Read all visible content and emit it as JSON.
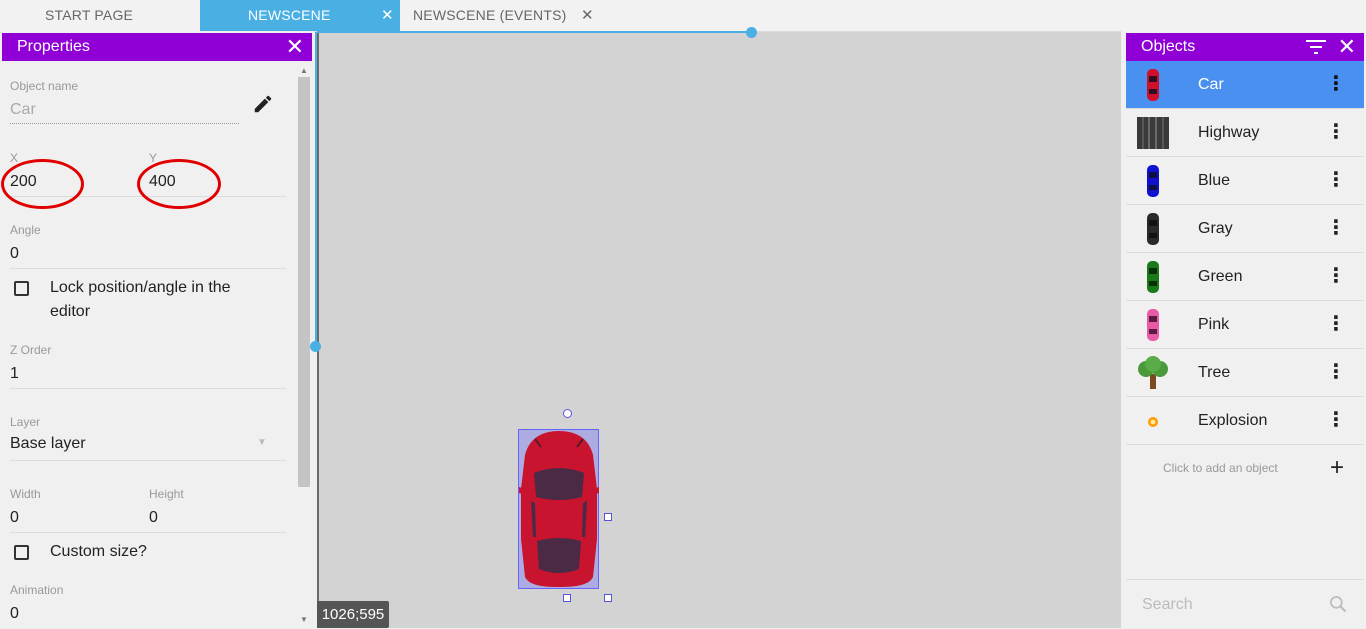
{
  "tabs": [
    {
      "label": "START PAGE",
      "active": false,
      "closable": false
    },
    {
      "label": "NEWSCENE",
      "active": true,
      "closable": true
    },
    {
      "label": "NEWSCENE (EVENTS)",
      "active": false,
      "closable": true
    }
  ],
  "properties": {
    "title": "Properties",
    "object_name_label": "Object name",
    "object_name_value": "Car",
    "x_label": "X",
    "x_value": "200",
    "y_label": "Y",
    "y_value": "400",
    "angle_label": "Angle",
    "angle_value": "0",
    "lock_label": "Lock position/angle in the editor",
    "lock_line1": "Lock position/angle in the",
    "lock_line2": "editor",
    "zorder_label": "Z Order",
    "zorder_value": "1",
    "layer_label": "Layer",
    "layer_value": "Base layer",
    "width_label": "Width",
    "width_value": "0",
    "height_label": "Height",
    "height_value": "0",
    "custom_size_label": "Custom size?",
    "animation_label": "Animation",
    "animation_value": "0"
  },
  "scene": {
    "cursor_coords": "1026;595"
  },
  "objects": {
    "title": "Objects",
    "items": [
      {
        "name": "Car",
        "icon": "red-car-icon",
        "color": "#d0102a",
        "selected": true
      },
      {
        "name": "Highway",
        "icon": "highway-icon",
        "color": "#3a3a3a",
        "selected": false
      },
      {
        "name": "Blue",
        "icon": "blue-car-icon",
        "color": "#1010d0",
        "selected": false
      },
      {
        "name": "Gray",
        "icon": "gray-car-icon",
        "color": "#2a2a2a",
        "selected": false
      },
      {
        "name": "Green",
        "icon": "green-car-icon",
        "color": "#1a7a1a",
        "selected": false
      },
      {
        "name": "Pink",
        "icon": "pink-car-icon",
        "color": "#e85aa8",
        "selected": false
      },
      {
        "name": "Tree",
        "icon": "tree-icon",
        "color": "#4a9a3a",
        "selected": false
      },
      {
        "name": "Explosion",
        "icon": "explosion-icon",
        "color": "#ff9a00",
        "selected": false
      }
    ],
    "add_label": "Click to add an object",
    "search_placeholder": "Search"
  },
  "colors": {
    "accent_purple": "#9000d6",
    "tab_active": "#4ab0e4",
    "selected_row": "#4a90f0",
    "annotation_red": "#e00000"
  }
}
